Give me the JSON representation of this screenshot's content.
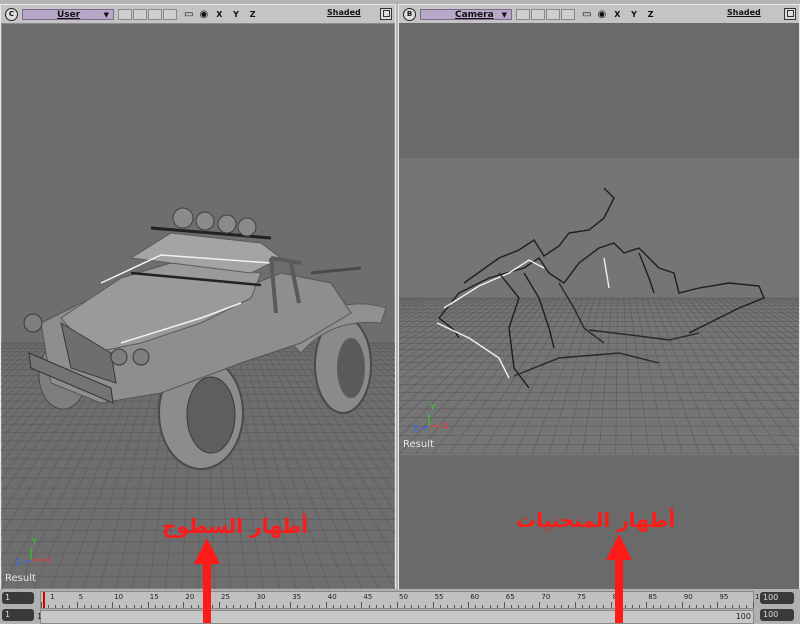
{
  "left_viewport": {
    "letter": "C",
    "view_name": "User",
    "shading": "Shaded",
    "axes": "X Y Z",
    "result": "Result",
    "caption": "أظهار السطوح",
    "gizmo": {
      "x": "X",
      "y": "Y",
      "z": "Z"
    }
  },
  "right_viewport": {
    "letter": "B",
    "view_name": "Camera",
    "shading": "Shaded",
    "axes": "X Y Z",
    "result": "Result",
    "caption": "أظهار المنحنيات",
    "gizmo": {
      "x": "X",
      "y": "Y",
      "z": "Z"
    }
  },
  "timeline": {
    "start_frame": "1",
    "current_frame": "1",
    "end_frame": "100",
    "range_end": "100",
    "slider_start": "1",
    "slider_end": "100",
    "ticks": [
      "1",
      "5",
      "10",
      "15",
      "20",
      "25",
      "30",
      "35",
      "40",
      "45",
      "50",
      "55",
      "60",
      "65",
      "70",
      "75",
      "80",
      "85",
      "90",
      "95",
      "100"
    ]
  },
  "colors": {
    "caption": "#ff1a1a",
    "viewport_bg": "#6e6e6e",
    "menu_purple": "#b8a8c8"
  }
}
